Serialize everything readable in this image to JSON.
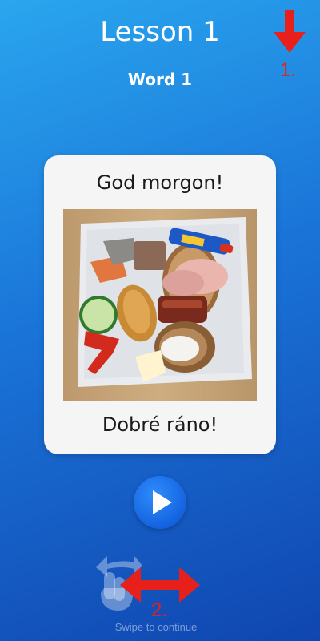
{
  "header": {
    "lesson_title": "Lesson 1",
    "word_title": "Word 1"
  },
  "card": {
    "source_phrase": "God morgon!",
    "target_phrase": "Dobré ráno!",
    "image_label": "breakfast plate photo"
  },
  "controls": {
    "play_icon": "play-icon"
  },
  "footer": {
    "swipe_hint": "Swipe to continue",
    "swipe_icon": "swipe-hand-icon"
  },
  "annotations": {
    "marker_1": "1.",
    "marker_2": "2.",
    "color": "#e8201c"
  },
  "colors": {
    "background_top": "#2aa6ee",
    "background_bottom": "#1046b0",
    "card": "#f5f5f5",
    "play_button": "#1463e0"
  }
}
